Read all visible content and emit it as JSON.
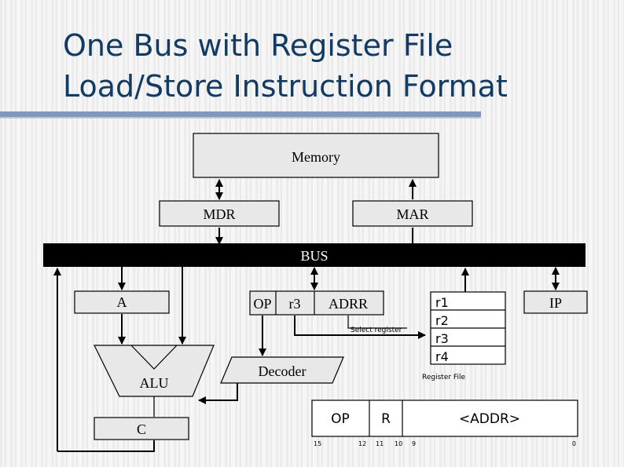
{
  "slide": {
    "title_line1": "One Bus with Register File",
    "title_line2": "Load/Store Instruction Format",
    "title_color": "#123a63",
    "rule_color": "#8099bb",
    "background_color": "#f2f2f2"
  },
  "diagram": {
    "memory_label": "Memory",
    "mdr_label": "MDR",
    "mar_label": "MAR",
    "bus_label": "BUS",
    "a_label": "A",
    "alu_label": "ALU",
    "c_label": "C",
    "decoder_label": "Decoder",
    "ip_label": "IP",
    "select_register_label": "Select register",
    "register_file_caption": "Register File",
    "instruction_register": {
      "op": "OP",
      "reg": "r3",
      "addr": "ADRR"
    },
    "register_file": {
      "cells": [
        "r1",
        "r2",
        "r3",
        "r4"
      ]
    },
    "instruction_format": {
      "fields": [
        {
          "name": "OP"
        },
        {
          "name": "R"
        },
        {
          "name": "<ADDR>"
        }
      ],
      "bit_labels": [
        "15",
        "12",
        "11",
        "10",
        "9",
        "0"
      ]
    },
    "box_fill_color": "#e8e8e8",
    "cell_fill_color": "#ffffff",
    "bus_color": "#000000",
    "line_color": "#000000"
  }
}
